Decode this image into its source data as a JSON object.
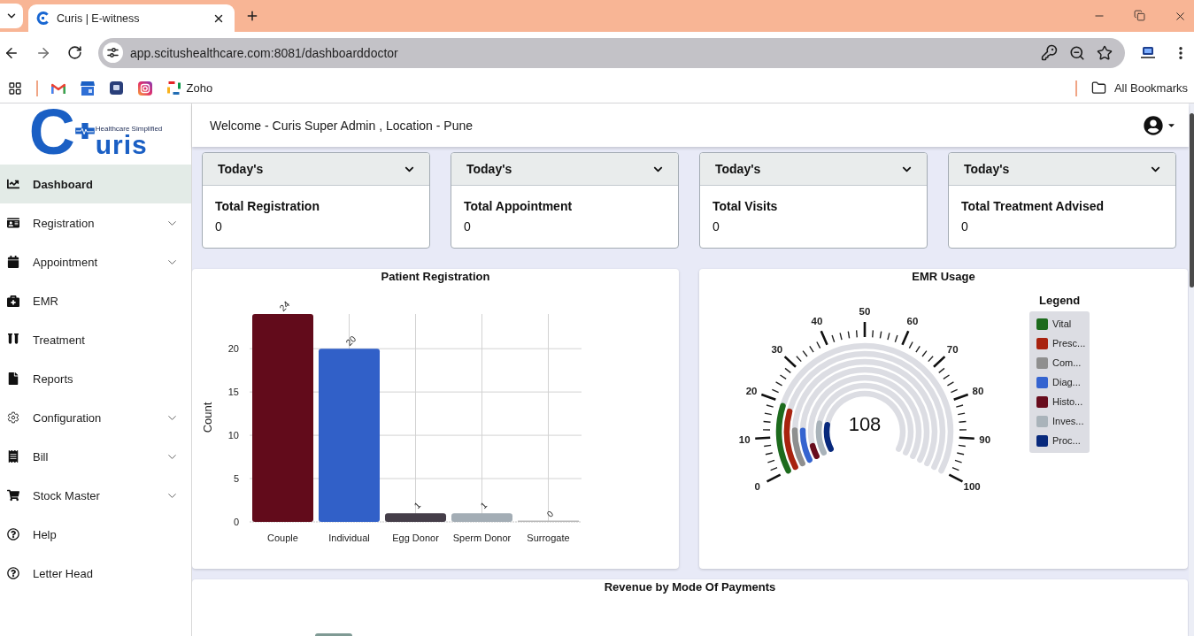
{
  "browser": {
    "tabs": [
      {
        "title": "Curis | E-witness",
        "selected": true
      }
    ],
    "address": "app.scitushealthcare.com:8081/dashboarddoctor",
    "bookmarks": [
      {
        "label": "Zoho"
      }
    ],
    "all_bookmarks": "All Bookmarks"
  },
  "logo": {
    "mark": "C",
    "wordmark": "uris",
    "tagline": "Healthcare Simplified"
  },
  "sidebar": {
    "items": [
      {
        "label": "Dashboard",
        "selected": true,
        "submenu": false
      },
      {
        "label": "Registration",
        "selected": false,
        "submenu": true
      },
      {
        "label": "Appointment",
        "selected": false,
        "submenu": true
      },
      {
        "label": "EMR",
        "selected": false,
        "submenu": false
      },
      {
        "label": "Treatment",
        "selected": false,
        "submenu": false
      },
      {
        "label": "Reports",
        "selected": false,
        "submenu": false
      },
      {
        "label": "Configuration",
        "selected": false,
        "submenu": true
      },
      {
        "label": "Bill",
        "selected": false,
        "submenu": true
      },
      {
        "label": "Stock Master",
        "selected": false,
        "submenu": true
      },
      {
        "label": "Help",
        "selected": false,
        "submenu": false
      },
      {
        "label": "Letter Head",
        "selected": false,
        "submenu": false
      }
    ]
  },
  "header": {
    "welcome": "Welcome - Curis Super Admin , Location - Pune"
  },
  "stat_cards": [
    {
      "period": "Today's",
      "label": "Total Registration",
      "value": "0"
    },
    {
      "period": "Today's",
      "label": "Total Appointment",
      "value": "0"
    },
    {
      "period": "Today's",
      "label": "Total Visits",
      "value": "0"
    },
    {
      "period": "Today's",
      "label": "Total Treatment Advised",
      "value": "0"
    }
  ],
  "patient_registration": {
    "chart_data": {
      "type": "bar",
      "title": "Patient Registration",
      "ylabel": "Count",
      "categories": [
        "Couple",
        "Individual",
        "Egg Donor",
        "Sperm Donor",
        "Surrogate"
      ],
      "values": [
        24,
        20,
        1,
        1,
        0
      ],
      "colors": [
        "#620b1b",
        "#3160c8",
        "#453e49",
        "#a3adb5",
        "#b8b8b8"
      ],
      "ylim": [
        0,
        24
      ],
      "yticks": [
        0,
        5,
        10,
        15,
        20
      ],
      "grid": true,
      "data_labels": true
    }
  },
  "emr_usage": {
    "title": "EMR Usage",
    "scale_labels": [
      "0",
      "10",
      "20",
      "30",
      "40",
      "50",
      "60",
      "70",
      "80",
      "90",
      "100"
    ],
    "total": "108",
    "legend_title": "Legend",
    "legend": [
      {
        "label": "Vital",
        "color": "#1d6b1d"
      },
      {
        "label": "Presc...",
        "color": "#a8230f"
      },
      {
        "label": "Com...",
        "color": "#8f8f8f"
      },
      {
        "label": "Diag...",
        "color": "#3564d0"
      },
      {
        "label": "Histo...",
        "color": "#680d1d"
      },
      {
        "label": "Inves...",
        "color": "#a9b3ba"
      },
      {
        "label": "Proc...",
        "color": "#08297c"
      }
    ]
  },
  "revenue": {
    "title": "Revenue by Mode Of Payments"
  }
}
